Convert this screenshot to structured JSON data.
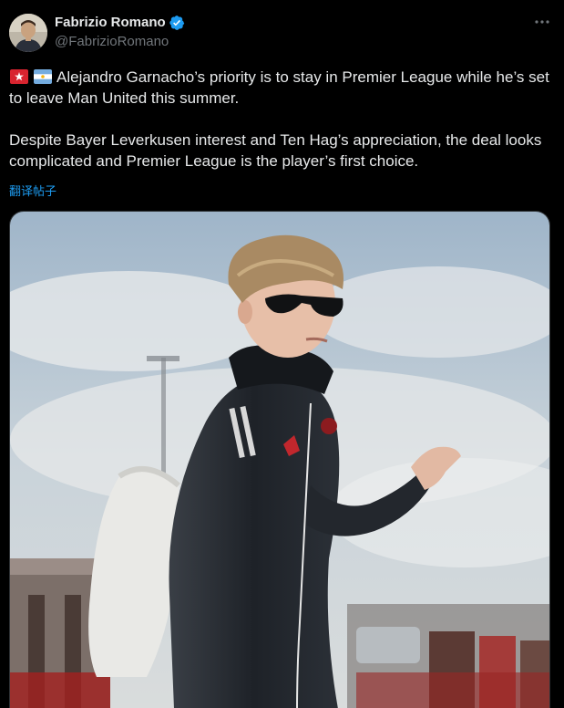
{
  "tweet": {
    "author_name": "Fabrizio Romano",
    "author_handle": "@FabrizioRomano",
    "verified": true,
    "flags": [
      "red-devil-emoji",
      "argentina-flag-emoji"
    ],
    "paragraph_1": "Alejandro Garnacho’s priority is to stay in Premier League while he’s set to leave Man United this summer.",
    "paragraph_2": "Despite Bayer Leverkusen interest and Ten Hag’s appreciation, the deal looks complicated and Premier League is the player’s first choice.",
    "translate_label": "翻译帖子",
    "more_icon": "more-horizontal-icon",
    "media": "photo"
  },
  "colors": {
    "background": "#000000",
    "text": "#e7e9ea",
    "secondary_text": "#71767b",
    "link": "#1d9bf0",
    "verified": "#1d9bf0"
  }
}
